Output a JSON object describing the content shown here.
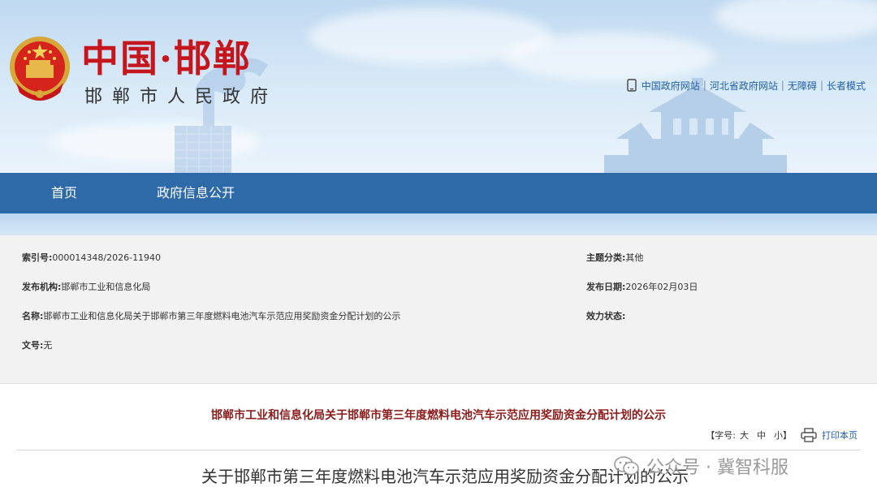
{
  "header": {
    "site_title": "中国·邯郸",
    "site_subtitle": "邯郸市人民政府",
    "top_links": [
      "中国政府网站",
      "河北省政府网站",
      "无障碍",
      "长者模式"
    ],
    "separator": "|"
  },
  "nav": {
    "items": [
      "首页",
      "政府信息公开"
    ]
  },
  "info": {
    "index_label": "索引号:",
    "index_value": "000014348/2026-11940",
    "topic_label": "主题分类:",
    "topic_value": "其他",
    "publisher_label": "发布机构:",
    "publisher_value": "邯郸市工业和信息化局",
    "date_label": "发布日期:",
    "date_value": "2026年02月03日",
    "name_label": "名称:",
    "name_value": "邯郸市工业和信息化局关于邯郸市第三年度燃料电池汽车示范应用奖励资金分配计划的公示",
    "validity_label": "效力状态:",
    "validity_value": "",
    "docno_label": "文号:",
    "docno_value": "无"
  },
  "article": {
    "title": "邯郸市工业和信息化局关于邯郸市第三年度燃料电池汽车示范应用奖励资金分配计划的公示",
    "font_label": "【字号:",
    "font_large": "大",
    "font_medium": "中",
    "font_small": "小】",
    "print_label": "打印本页",
    "heading": "关于邯郸市第三年度燃料电池汽车示范应用奖励资金分配计划的公示"
  },
  "watermark": {
    "text": "公众号 · 冀智科服"
  },
  "colors": {
    "brand_red": "#c4161c",
    "nav_blue": "#2f6aa8",
    "link_blue": "#1f5fa8",
    "title_dark_red": "#8b1c1c"
  }
}
